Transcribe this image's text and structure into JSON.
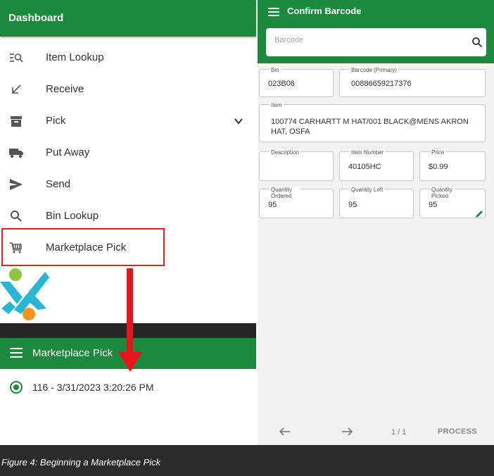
{
  "dashboard": {
    "title": "Dashboard",
    "menu": [
      {
        "label": "Item Lookup",
        "icon": "list-search-icon"
      },
      {
        "label": "Receive",
        "icon": "arrow-down-left-icon"
      },
      {
        "label": "Pick",
        "icon": "archive-box-icon"
      },
      {
        "label": "Put Away",
        "icon": "truck-icon"
      },
      {
        "label": "Send",
        "icon": "send-icon"
      },
      {
        "label": "Bin Lookup",
        "icon": "search-icon"
      },
      {
        "label": "Marketplace Pick",
        "icon": "shopping-cart-icon"
      }
    ]
  },
  "marketplace_pick": {
    "title": "Marketplace Pick",
    "entry": "116 - 3/31/2023 3:20:26 PM"
  },
  "confirm_barcode": {
    "title": "Confirm Barcode",
    "search_placeholder": "Barcode",
    "fields": {
      "bin": {
        "label": "Bin",
        "value": "023B06"
      },
      "barcode_primary": {
        "label": "Barcode (Primary)",
        "value": "00886659217376"
      },
      "item": {
        "label": "Item",
        "value": "100774 CARHARTT M HAT/001 BLACK@MENS AKRON HAT, OSFA"
      },
      "description": {
        "label": "Description",
        "value": ""
      },
      "item_number": {
        "label": "Item Number",
        "value": "40105HC"
      },
      "price": {
        "label": "Price",
        "value": "$0.99"
      },
      "quantity_ordered": {
        "label": "Quantity Ordered",
        "value": "95"
      },
      "quantity_left": {
        "label": "Quantity Left",
        "value": "95"
      },
      "quantity_picked": {
        "label": "Quantity Picked",
        "value": "95"
      }
    },
    "footer": {
      "page": "1 / 1",
      "process": "PROCESS"
    }
  },
  "caption": "Figure 4: Beginning a Marketplace Pick",
  "colors": {
    "brand_green": "#1b8a3c",
    "highlight_red": "#e02020",
    "arrow_red": "#e8131b"
  }
}
